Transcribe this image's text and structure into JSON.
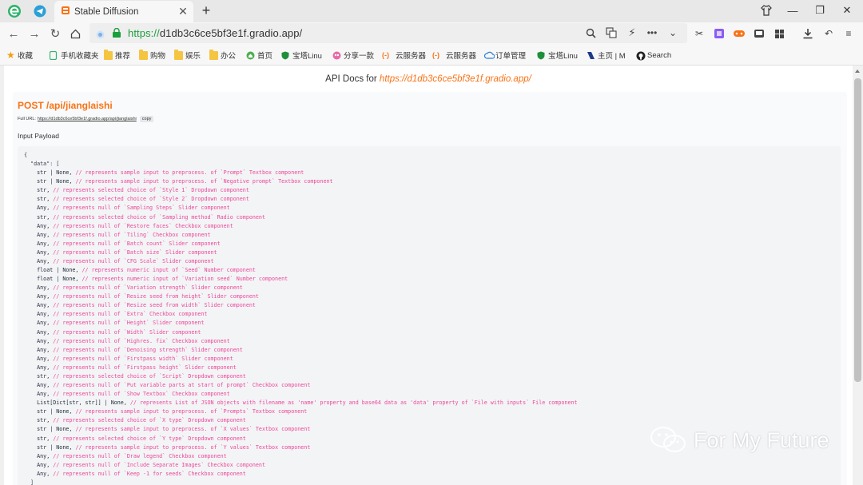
{
  "browser": {
    "tab_title": "Stable Diffusion",
    "url_scheme": "https://",
    "url_host": "d1db3c6ce5bf3e1f.gradio.app/",
    "bookmarks": [
      {
        "label": "收藏",
        "icon": "star-icon"
      },
      {
        "label": "手机收藏夹",
        "icon": "phone-icon"
      },
      {
        "label": "推荐",
        "icon": "folder-icon"
      },
      {
        "label": "购物",
        "icon": "folder-icon"
      },
      {
        "label": "娱乐",
        "icon": "folder-icon"
      },
      {
        "label": "办公",
        "icon": "folder-icon"
      },
      {
        "label": "首页",
        "icon": "home-icon"
      },
      {
        "label": "宝塔Linu",
        "icon": "shield-icon"
      },
      {
        "label": "分享一款",
        "icon": "share-icon"
      },
      {
        "label": "云服务器",
        "icon": "cloud-brackets-icon"
      },
      {
        "label": "云服务器",
        "icon": "cloud-brackets-icon"
      },
      {
        "label": "订单管理",
        "icon": "cloud-icon"
      },
      {
        "label": "宝塔Linu",
        "icon": "shield-icon"
      },
      {
        "label": "主页 | M",
        "icon": "bookmark-icon"
      },
      {
        "label": "Search",
        "icon": "github-icon"
      }
    ]
  },
  "page": {
    "heading_prefix": "API Docs for ",
    "heading_link": "https://d1db3c6ce5bf3e1f.gradio.app/",
    "endpoint": "POST /api/jianglaishi",
    "full_url_label": "Full URL:",
    "full_url": "https://d1db3c6ce5bf3e1f.gradio.app/api/jianglaishi",
    "copy_label": "copy",
    "input_payload_label": "Input Payload",
    "code_open": "{",
    "code_data_key": "  \"data\": [",
    "code_lines": [
      {
        "type": "str | None,",
        "comment": "// represents sample input to preprocess. of `Prompt` Textbox component"
      },
      {
        "type": "str | None,",
        "comment": "// represents sample input to preprocess. of `Negative prompt` Textbox component"
      },
      {
        "type": "str,",
        "comment": "// represents selected choice of `Style 1` Dropdown component"
      },
      {
        "type": "str,",
        "comment": "// represents selected choice of `Style 2` Dropdown component"
      },
      {
        "type": "Any,",
        "comment": "// represents null of `Sampling Steps` Slider component"
      },
      {
        "type": "str,",
        "comment": "// represents selected choice of `Sampling method` Radio component"
      },
      {
        "type": "Any,",
        "comment": "// represents null of `Restore faces` Checkbox component"
      },
      {
        "type": "Any,",
        "comment": "// represents null of `Tiling` Checkbox component"
      },
      {
        "type": "Any,",
        "comment": "// represents null of `Batch count` Slider component"
      },
      {
        "type": "Any,",
        "comment": "// represents null of `Batch size` Slider component"
      },
      {
        "type": "Any,",
        "comment": "// represents null of `CFG Scale` Slider component"
      },
      {
        "type": "float | None,",
        "comment": "// represents numeric input of `Seed` Number component"
      },
      {
        "type": "float | None,",
        "comment": "// represents numeric input of `Variation seed` Number component"
      },
      {
        "type": "Any,",
        "comment": "// represents null of `Variation strength` Slider component"
      },
      {
        "type": "Any,",
        "comment": "// represents null of `Resize seed from height` Slider component"
      },
      {
        "type": "Any,",
        "comment": "// represents null of `Resize seed from width` Slider component"
      },
      {
        "type": "Any,",
        "comment": "// represents null of `Extra` Checkbox component"
      },
      {
        "type": "Any,",
        "comment": "// represents null of `Height` Slider component"
      },
      {
        "type": "Any,",
        "comment": "// represents null of `Width` Slider component"
      },
      {
        "type": "Any,",
        "comment": "// represents null of `Highres. fix` Checkbox component"
      },
      {
        "type": "Any,",
        "comment": "// represents null of `Denoising strength` Slider component"
      },
      {
        "type": "Any,",
        "comment": "// represents null of `Firstpass width` Slider component"
      },
      {
        "type": "Any,",
        "comment": "// represents null of `Firstpass height` Slider component"
      },
      {
        "type": "str,",
        "comment": "// represents selected choice of `Script` Dropdown component"
      },
      {
        "type": "Any,",
        "comment": "// represents null of `Put variable parts at start of prompt` Checkbox component"
      },
      {
        "type": "Any,",
        "comment": "// represents null of `Show Textbox` Checkbox component"
      },
      {
        "type": "List[Dict[str, str]] | None,",
        "comment": "// represents List of JSON objects with filename as 'name' property and base64 data as 'data' property of `File with inputs` File component"
      },
      {
        "type": "str | None,",
        "comment": "// represents sample input to preprocess. of `Prompts` Textbox component"
      },
      {
        "type": "str,",
        "comment": "// represents selected choice of `X type` Dropdown component"
      },
      {
        "type": "str | None,",
        "comment": "// represents sample input to preprocess. of `X values` Textbox component"
      },
      {
        "type": "str,",
        "comment": "// represents selected choice of `Y type` Dropdown component"
      },
      {
        "type": "str | None,",
        "comment": "// represents sample input to preprocess. of `Y values` Textbox component"
      },
      {
        "type": "Any,",
        "comment": "// represents null of `Draw legend` Checkbox component"
      },
      {
        "type": "Any,",
        "comment": "// represents null of `Include Separate Images` Checkbox component"
      },
      {
        "type": "Any,",
        "comment": "// represents null of `Keep -1 for seeds` Checkbox component"
      }
    ],
    "code_close": "  ]"
  },
  "watermark": "For My Future"
}
